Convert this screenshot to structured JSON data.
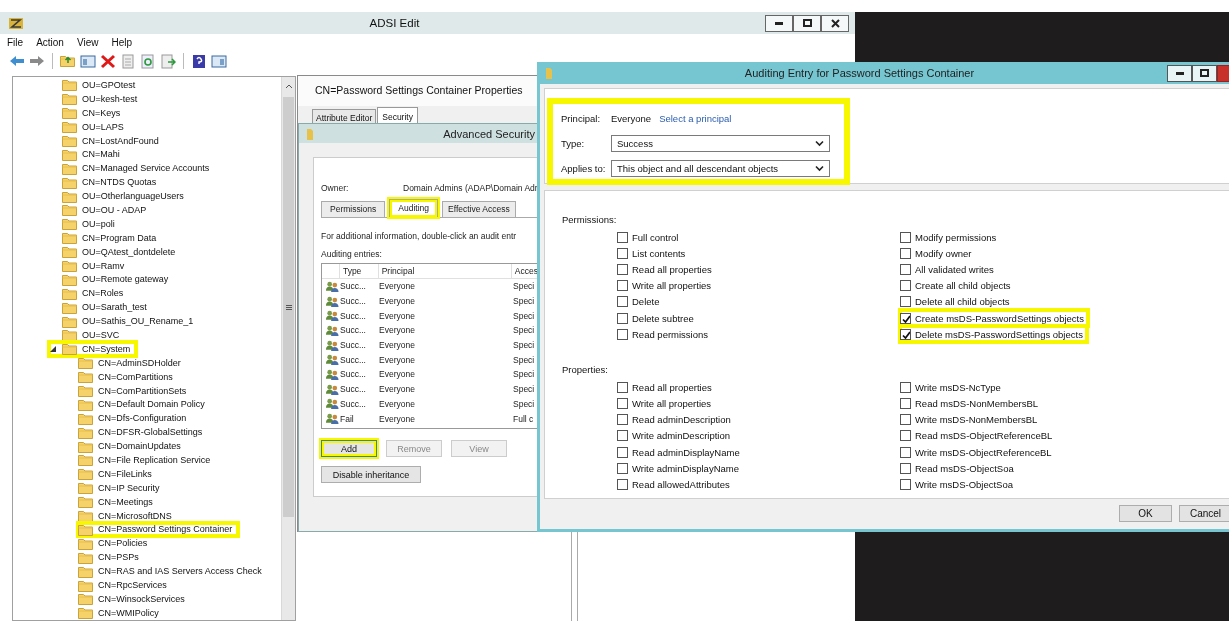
{
  "adsi_window": {
    "title": "ADSI Edit",
    "menu": [
      "File",
      "Action",
      "View",
      "Help"
    ]
  },
  "tree": {
    "items": [
      {
        "label": "OU=GPOtest",
        "highlighted": false
      },
      {
        "label": "OU=kesh-test",
        "highlighted": false
      },
      {
        "label": "CN=Keys",
        "highlighted": false
      },
      {
        "label": "OU=LAPS",
        "highlighted": false
      },
      {
        "label": "CN=LostAndFound",
        "highlighted": false
      },
      {
        "label": "CN=Mahi",
        "highlighted": false
      },
      {
        "label": "CN=Managed Service Accounts",
        "highlighted": false
      },
      {
        "label": "CN=NTDS Quotas",
        "highlighted": false
      },
      {
        "label": "OU=OtherlanguageUsers",
        "highlighted": false
      },
      {
        "label": "OU=OU - ADAP",
        "highlighted": false
      },
      {
        "label": "OU=poli",
        "highlighted": false
      },
      {
        "label": "CN=Program Data",
        "highlighted": false
      },
      {
        "label": "OU=QAtest_dontdelete",
        "highlighted": false
      },
      {
        "label": "OU=Ramv",
        "highlighted": false
      },
      {
        "label": "OU=Remote gateway",
        "highlighted": false
      },
      {
        "label": "CN=Roles",
        "highlighted": false
      },
      {
        "label": "OU=Sarath_test",
        "highlighted": false
      },
      {
        "label": "OU=Sathis_OU_Rename_1",
        "highlighted": false
      },
      {
        "label": "OU=SVC",
        "highlighted": false
      },
      {
        "label": "CN=System",
        "highlighted": true,
        "expanded": true,
        "children": [
          {
            "label": "CN=AdminSDHolder",
            "highlighted": false
          },
          {
            "label": "CN=ComPartitions",
            "highlighted": false
          },
          {
            "label": "CN=ComPartitionSets",
            "highlighted": false
          },
          {
            "label": "CN=Default Domain Policy",
            "highlighted": false
          },
          {
            "label": "CN=Dfs-Configuration",
            "highlighted": false
          },
          {
            "label": "CN=DFSR-GlobalSettings",
            "highlighted": false
          },
          {
            "label": "CN=DomainUpdates",
            "highlighted": false
          },
          {
            "label": "CN=File Replication Service",
            "highlighted": false
          },
          {
            "label": "CN=FileLinks",
            "highlighted": false
          },
          {
            "label": "CN=IP Security",
            "highlighted": false
          },
          {
            "label": "CN=Meetings",
            "highlighted": false
          },
          {
            "label": "CN=MicrosoftDNS",
            "highlighted": false
          },
          {
            "label": "CN=Password Settings Container",
            "highlighted": true
          },
          {
            "label": "CN=Policies",
            "highlighted": false
          },
          {
            "label": "CN=PSPs",
            "highlighted": false
          },
          {
            "label": "CN=RAS and IAS Servers Access Check",
            "highlighted": false
          },
          {
            "label": "CN=RpcServices",
            "highlighted": false
          },
          {
            "label": "CN=WinsockServices",
            "highlighted": false
          },
          {
            "label": "CN=WMIPolicy",
            "highlighted": false
          }
        ]
      }
    ]
  },
  "properties_dialog": {
    "title": "CN=Password Settings Container Properties",
    "tabs": [
      {
        "label": "Attribute Editor",
        "selected": false
      },
      {
        "label": "Security",
        "selected": true
      }
    ]
  },
  "advanced_security": {
    "title": "Advanced Security",
    "owner_label": "Owner:",
    "owner": "Domain Admins (ADAP\\Domain Adr",
    "tabs": [
      {
        "label": "Permissions",
        "selected": false,
        "highlighted": false
      },
      {
        "label": "Auditing",
        "selected": true,
        "highlighted": true
      },
      {
        "label": "Effective Access",
        "selected": false,
        "highlighted": false
      }
    ],
    "info": "For additional information, double-click an audit entr",
    "entries_label": "Auditing entries:",
    "columns": [
      "Type",
      "Principal",
      "Acces"
    ],
    "rows": [
      {
        "type": "Succ...",
        "principal": "Everyone",
        "access": "Speci"
      },
      {
        "type": "Succ...",
        "principal": "Everyone",
        "access": "Speci"
      },
      {
        "type": "Succ...",
        "principal": "Everyone",
        "access": "Speci"
      },
      {
        "type": "Succ...",
        "principal": "Everyone",
        "access": "Speci"
      },
      {
        "type": "Succ...",
        "principal": "Everyone",
        "access": "Speci"
      },
      {
        "type": "Succ...",
        "principal": "Everyone",
        "access": "Speci"
      },
      {
        "type": "Succ...",
        "principal": "Everyone",
        "access": "Speci"
      },
      {
        "type": "Succ...",
        "principal": "Everyone",
        "access": "Speci"
      },
      {
        "type": "Succ...",
        "principal": "Everyone",
        "access": "Speci"
      },
      {
        "type": "Fail",
        "principal": "Everyone",
        "access": "Full c"
      }
    ],
    "buttons": [
      {
        "label": "Add",
        "disabled": false,
        "highlighted": true
      },
      {
        "label": "Remove",
        "disabled": true,
        "highlighted": false
      },
      {
        "label": "View",
        "disabled": true,
        "highlighted": false
      }
    ],
    "disable_inheritance": "Disable inheritance"
  },
  "auditing_entry": {
    "title": "Auditing Entry for Password Settings Container",
    "principal": {
      "label": "Principal:",
      "value": "Everyone",
      "link": "Select a principal",
      "highlighted": true
    },
    "type": {
      "label": "Type:",
      "value": "Success"
    },
    "applies_to": {
      "label": "Applies to:",
      "value": "This object and all descendant objects"
    },
    "permissions": {
      "label": "Permissions:",
      "columns": [
        {
          "items": [
            {
              "label": "Full control",
              "checked": false,
              "highlighted": false
            },
            {
              "label": "List contents",
              "checked": false,
              "highlighted": false
            },
            {
              "label": "Read all properties",
              "checked": false,
              "highlighted": false
            },
            {
              "label": "Write all properties",
              "checked": false,
              "highlighted": false
            },
            {
              "label": "Delete",
              "checked": false,
              "highlighted": false
            },
            {
              "label": "Delete subtree",
              "checked": false,
              "highlighted": false
            },
            {
              "label": "Read permissions",
              "checked": false,
              "highlighted": false
            }
          ]
        },
        {
          "items": [
            {
              "label": "Modify permissions",
              "checked": false,
              "highlighted": false
            },
            {
              "label": "Modify owner",
              "checked": false,
              "highlighted": false
            },
            {
              "label": "All validated writes",
              "checked": false,
              "highlighted": false
            },
            {
              "label": "Create all child objects",
              "checked": false,
              "highlighted": false
            },
            {
              "label": "Delete all child objects",
              "checked": false,
              "highlighted": false
            },
            {
              "label": "Create msDS-PasswordSettings objects",
              "checked": true,
              "highlighted": true
            },
            {
              "label": "Delete msDS-PasswordSettings objects",
              "checked": true,
              "highlighted": true
            }
          ]
        }
      ]
    },
    "properties": {
      "label": "Properties:",
      "columns": [
        {
          "items": [
            {
              "label": "Read all properties",
              "checked": false,
              "highlighted": false
            },
            {
              "label": "Write all properties",
              "checked": false,
              "highlighted": false
            },
            {
              "label": "Read adminDescription",
              "checked": false,
              "highlighted": false
            },
            {
              "label": "Write adminDescription",
              "checked": false,
              "highlighted": false
            },
            {
              "label": "Read adminDisplayName",
              "checked": false,
              "highlighted": false
            },
            {
              "label": "Write adminDisplayName",
              "checked": false,
              "highlighted": false
            },
            {
              "label": "Read allowedAttributes",
              "checked": false,
              "highlighted": false
            }
          ]
        },
        {
          "items": [
            {
              "label": "Write msDS-NcType",
              "checked": false,
              "highlighted": false
            },
            {
              "label": "Read msDS-NonMembersBL",
              "checked": false,
              "highlighted": false
            },
            {
              "label": "Write msDS-NonMembersBL",
              "checked": false,
              "highlighted": false
            },
            {
              "label": "Read msDS-ObjectReferenceBL",
              "checked": false,
              "highlighted": false
            },
            {
              "label": "Write msDS-ObjectReferenceBL",
              "checked": false,
              "highlighted": false
            },
            {
              "label": "Read msDS-ObjectSoa",
              "checked": false,
              "highlighted": false
            },
            {
              "label": "Write msDS-ObjectSoa",
              "checked": false,
              "highlighted": false
            }
          ]
        }
      ]
    },
    "buttons": [
      "OK",
      "Cancel"
    ]
  }
}
